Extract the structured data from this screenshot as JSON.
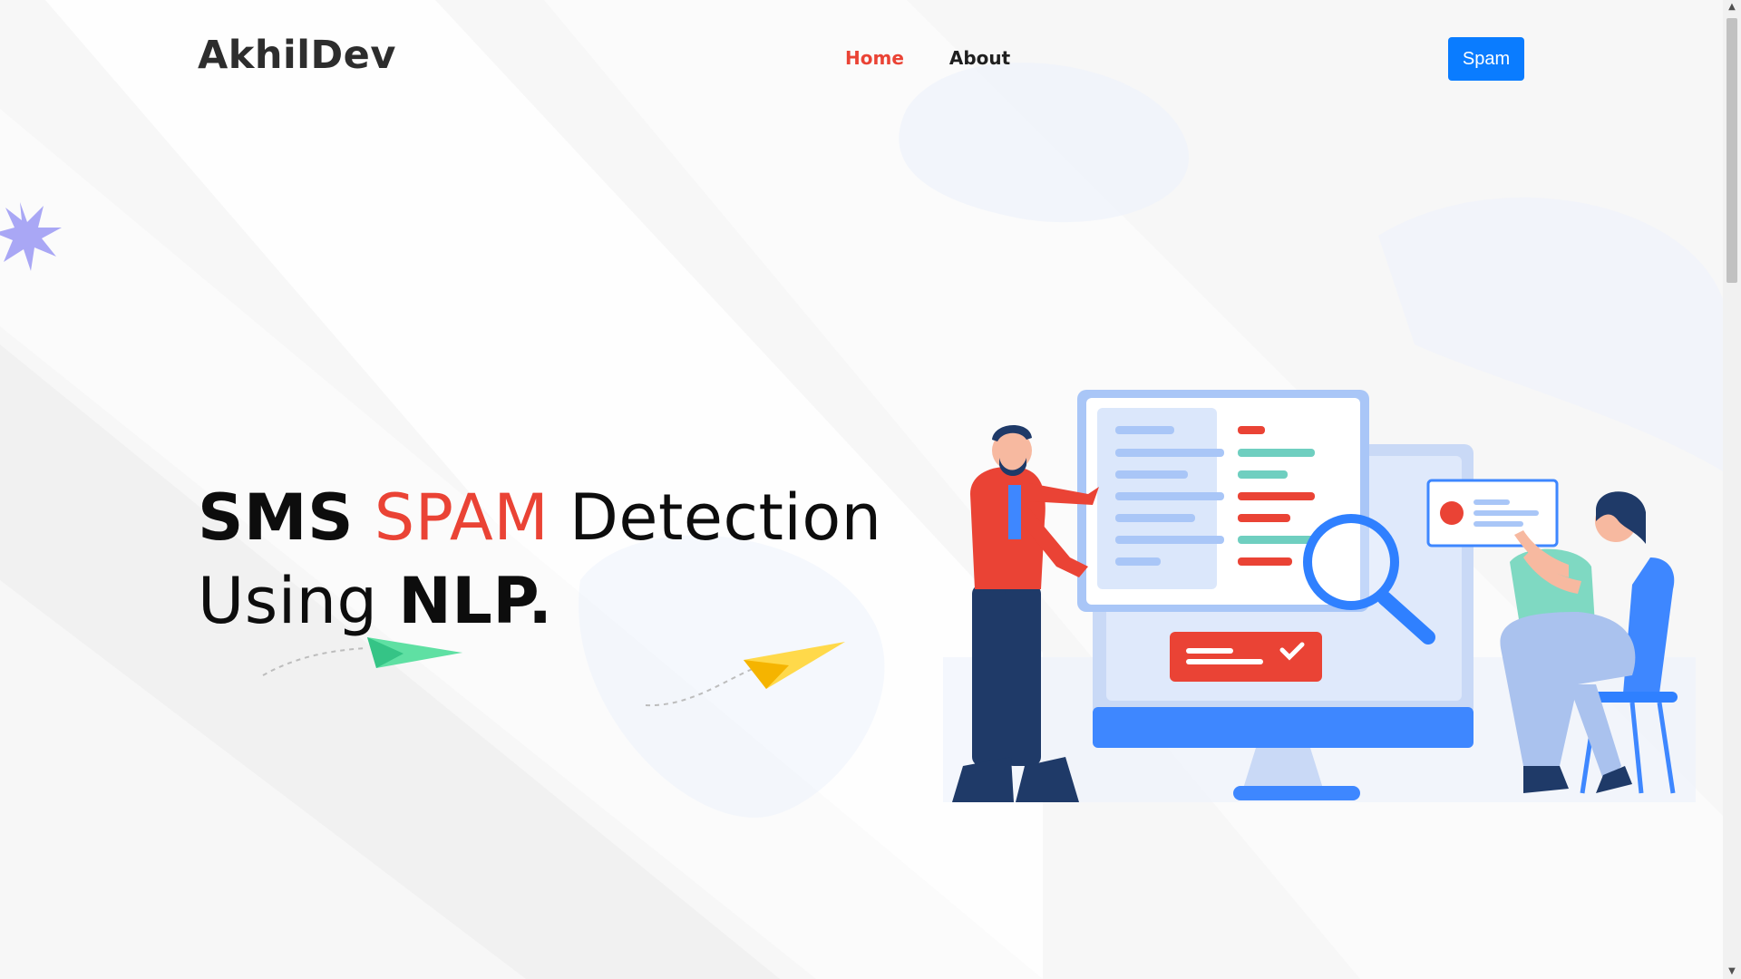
{
  "header": {
    "logo": "AkhilDev",
    "nav": [
      {
        "label": "Home",
        "active": true
      },
      {
        "label": "About",
        "active": false
      }
    ],
    "cta_label": "Spam"
  },
  "hero": {
    "word1": "SMS",
    "word2": "SPAM",
    "word3": "Detection",
    "word4": "Using",
    "word5": "NLP."
  },
  "colors": {
    "accent": "#ea4335",
    "button": "#0a7cff",
    "text": "#0d0d0d"
  },
  "icons": [
    "starburst-decoration",
    "paper-plane-green",
    "paper-plane-yellow",
    "spam-detection-illustration"
  ]
}
